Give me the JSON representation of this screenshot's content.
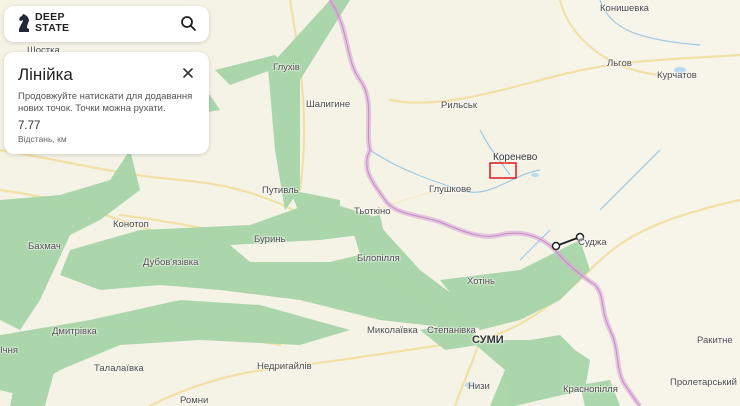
{
  "app": {
    "logo_line1": "DEEP",
    "logo_line2": "STATE",
    "search_icon": "search-icon"
  },
  "ruler_panel": {
    "title": "Лінійка",
    "hint": "Продовжуйте натискати для додавання нових точок. Точки можна рухати.",
    "distance_value": "7.77",
    "distance_label": "Відстань, км",
    "close_icon": "close-icon"
  },
  "map": {
    "colors": {
      "land": "#f5f3e6",
      "forest": "#a8d5a8",
      "forest_dark": "#8fc79a",
      "road": "#f2e0a6",
      "border": "#d9a8d8",
      "river": "#9cc9e6",
      "selection": "#e0262b"
    },
    "places": [
      {
        "name": "Шостка"
      },
      {
        "name": "Конишевка"
      },
      {
        "name": "Глухів"
      },
      {
        "name": "Льгов"
      },
      {
        "name": "Курчатов"
      },
      {
        "name": "Шалигине"
      },
      {
        "name": "Рильськ"
      },
      {
        "name": "Коренево"
      },
      {
        "name": "Глушкове"
      },
      {
        "name": "Путивль"
      },
      {
        "name": "Тьоткіно"
      },
      {
        "name": "Конотоп"
      },
      {
        "name": "Буринь"
      },
      {
        "name": "Суджа"
      },
      {
        "name": "Бахмач"
      },
      {
        "name": "Дубов'язівка"
      },
      {
        "name": "Білопілля"
      },
      {
        "name": "Хотінь"
      },
      {
        "name": "Дмитрівка"
      },
      {
        "name": "Миколаївка"
      },
      {
        "name": "Степанівка"
      },
      {
        "name": "СУМИ"
      },
      {
        "name": "Ракитне"
      },
      {
        "name": "Пролетарський"
      },
      {
        "name": "Талалаївка"
      },
      {
        "name": "Недригайлів"
      },
      {
        "name": "Низи"
      },
      {
        "name": "Краснопілля"
      },
      {
        "name": "Ромни"
      },
      {
        "name": "Ічня"
      }
    ]
  }
}
